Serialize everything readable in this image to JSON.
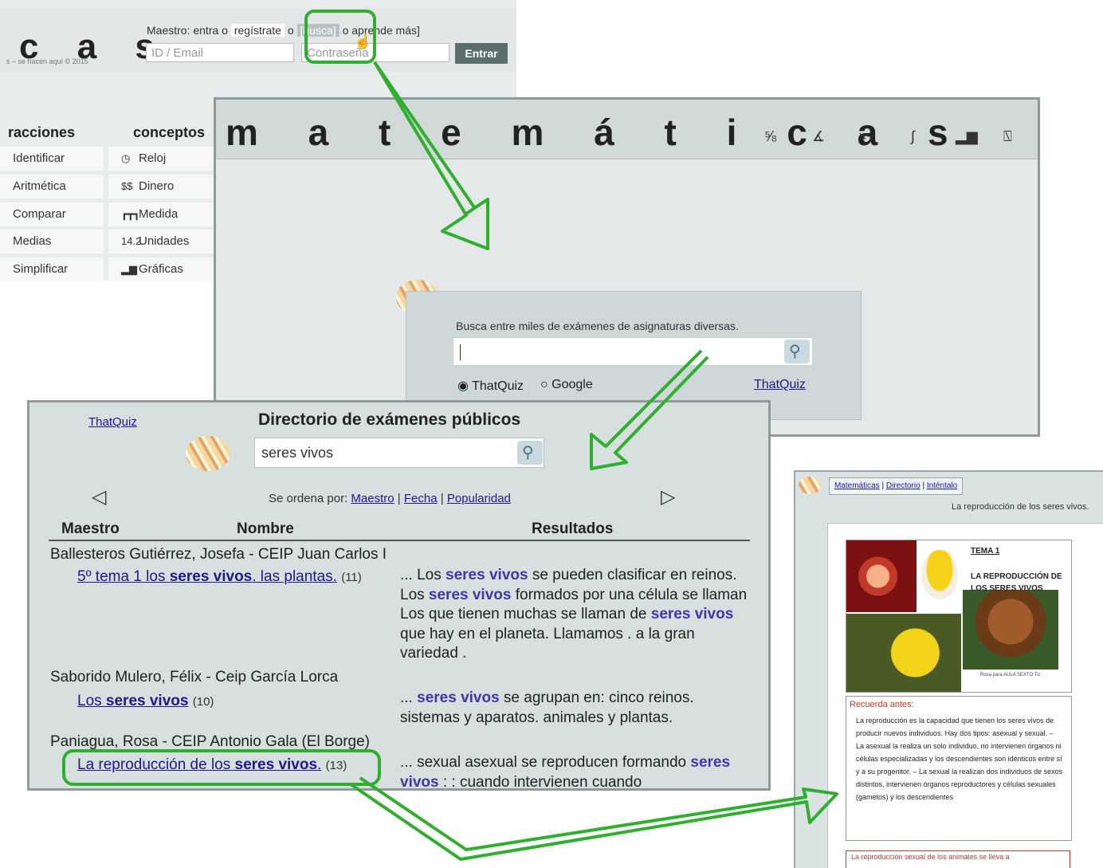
{
  "colors": {
    "annotation": "#2fae2f",
    "link": "#1a1a8c",
    "highlight": "#3a3aa8",
    "panel": "#d8dfdf"
  },
  "background_site": {
    "logo": "c a s",
    "copyright": "s – se hacen aquí © 2015",
    "prompt_lead": "Maestro: entra o",
    "prompt_register": "regístrate",
    "prompt_mid": "o",
    "prompt_search": "[busca]",
    "prompt_o": "o",
    "prompt_learn": "aprende más]",
    "id_placeholder": "ID / Email",
    "password_placeholder": "Contraseña",
    "enter_label": "Entrar",
    "column1_title": "racciones",
    "column2_title": "conceptos",
    "column1_items": [
      "Identificar",
      "Aritmética",
      "Comparar",
      "Medias",
      "Simplificar"
    ],
    "column2_items": [
      {
        "icon": "clock-icon",
        "glyph": "◷",
        "label": "Reloj"
      },
      {
        "icon": "money-icon",
        "glyph": "$$",
        "label": "Dinero"
      },
      {
        "icon": "ruler-icon",
        "glyph": "┏┳┓",
        "label": "Medida"
      },
      {
        "icon": "units-icon",
        "glyph": "14.2",
        "label": "Unidades"
      },
      {
        "icon": "bar-chart-icon",
        "glyph": "▂▆",
        "label": "Gráficas"
      }
    ]
  },
  "mat_window": {
    "title": "m a t e m á t i c a s",
    "toolbar_icons": [
      "fraction-icon",
      "angle-icon",
      "multiply-icon",
      "integral-icon",
      "bar-chart-icon",
      "ruler-slash-icon"
    ],
    "toolbar_glyphs": [
      "⅝",
      "∡",
      "×÷",
      "∫",
      "▂▆",
      "⍂"
    ],
    "search_label": "Busca entre miles de exámenes de asignaturas diversas.",
    "radio_thatquiz": "ThatQuiz",
    "radio_google": "Google",
    "thatquiz_link": "ThatQuiz"
  },
  "directory": {
    "home_link": "ThatQuiz",
    "title": "Directorio de exámenes públicos",
    "search_value": "seres vivos",
    "sort_label": "Se ordena por:",
    "sort_options": [
      "Maestro",
      "Fecha",
      "Popularidad"
    ],
    "sort_sep": "|",
    "col_teacher": "Maestro",
    "col_name": "Nombre",
    "col_results": "Resultados",
    "entries": [
      {
        "teacher": "Ballesteros Gutiérrez, Josefa - CEIP Juan Carlos I",
        "quiz_pre": "5º tema 1 los ",
        "quiz_hl": "seres vivos",
        "quiz_post": ". las plantas.",
        "count": "(11)",
        "result": [
          {
            "t": "... Los "
          },
          {
            "h": "seres vivos"
          },
          {
            "t": " se pueden clasificar en reinos. Los "
          },
          {
            "h": "seres vivos"
          },
          {
            "t": " formados por una célula se llaman Los que tienen muchas se llaman de "
          },
          {
            "h": "seres vivos"
          },
          {
            "t": " que hay en el planeta. Llamamos . a la gran variedad ."
          }
        ]
      },
      {
        "teacher": "Saborido Mulero, Félix - Ceip García Lorca",
        "quiz_pre": "Los ",
        "quiz_hl": "seres vivos",
        "quiz_post": "",
        "count": "(10)",
        "result": [
          {
            "t": "... "
          },
          {
            "h": "seres vivos"
          },
          {
            "t": " se agrupan en: cinco reinos. sistemas y aparatos. animales y plantas."
          }
        ]
      },
      {
        "teacher": "Paniagua, Rosa - CEIP Antonio Gala (El Borge)",
        "quiz_pre": "La reproducción de los ",
        "quiz_hl": "seres vivos",
        "quiz_post": ".",
        "count": "(13)",
        "result": [
          {
            "t": "... sexual asexual se reproducen formando "
          },
          {
            "h": "seres vivos"
          },
          {
            "t": " : : cuando intervienen cuando"
          }
        ]
      }
    ]
  },
  "quiz_preview": {
    "nav": [
      "Matemáticas",
      "Directorio",
      "Inténtalo"
    ],
    "nav_sep": "|",
    "title": "La reproducción de los seres vivos.",
    "tema": "TEMA 1",
    "heading": "LA REPRODUCCIÓN DE LOS SERES VIVOS",
    "credit": "Rosa para AULA SEXTO Tic",
    "recuerda": "Recuerda antes:",
    "recuerda_text": "La reproducción es la capacidad que tienen los seres vivos de producir nuevos individuos. Hay dos tipos: asexual y sexual. – La asexual la realiza un solo individuo, no intervienen órganos ni células especializadas y los descendientes son idénticos entre sí y a su progenitor. – La sexual la realizan dos individuos de sexos distintos, intervienen órganos reproductores y células sexuales (gametos) y los descendientes",
    "footer_text": "La reproducción sexual de los animales se lleva a"
  }
}
